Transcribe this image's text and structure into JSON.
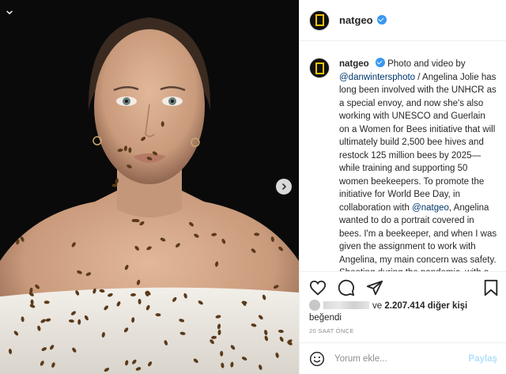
{
  "photo": {
    "alt": "Angelina Jolie portrait covered in bees"
  },
  "account": {
    "username": "natgeo",
    "verified": true
  },
  "caption": {
    "username": "natgeo",
    "part1": "Photo and video by ",
    "mention1": "@danwintersphoto",
    "part2": " / Angelina Jolie has long been involved with the UNHCR as a special envoy, and now she's also working with UNESCO and Guerlain on a Women for Bees initiative that will ultimately build 2,500 bee hives and restock 125 million bees by 2025—while training and supporting 50 women beekeepers. To promote the initiative for World Bee Day, in collaboration with ",
    "mention2": "@natgeo",
    "part3": ", Angelina wanted to do a portrait covered in bees. I'm a beekeeper, and when I was given the assignment to work with Angelina, my main concern was safety. Shooting during the pandemic, with a full crew and live bees, made the execution"
  },
  "likes": {
    "and_text": "ve",
    "count": "2.207.414",
    "others_text": "diğer kişi",
    "liked_text": "beğendi"
  },
  "timestamp": "20 SAAT ÖNCE",
  "comment": {
    "placeholder": "Yorum ekle...",
    "post_label": "Paylaş"
  },
  "icons": {
    "like": "heart-icon",
    "comment": "comment-icon",
    "share": "share-icon",
    "save": "bookmark-icon",
    "emoji": "emoji-icon",
    "next": "chevron-right-icon"
  },
  "colors": {
    "verified": "#3897f0",
    "link": "#00376b",
    "muted": "#8e8e8e",
    "post_button": "#b2dffc",
    "brand_frame": "#f5c400"
  }
}
